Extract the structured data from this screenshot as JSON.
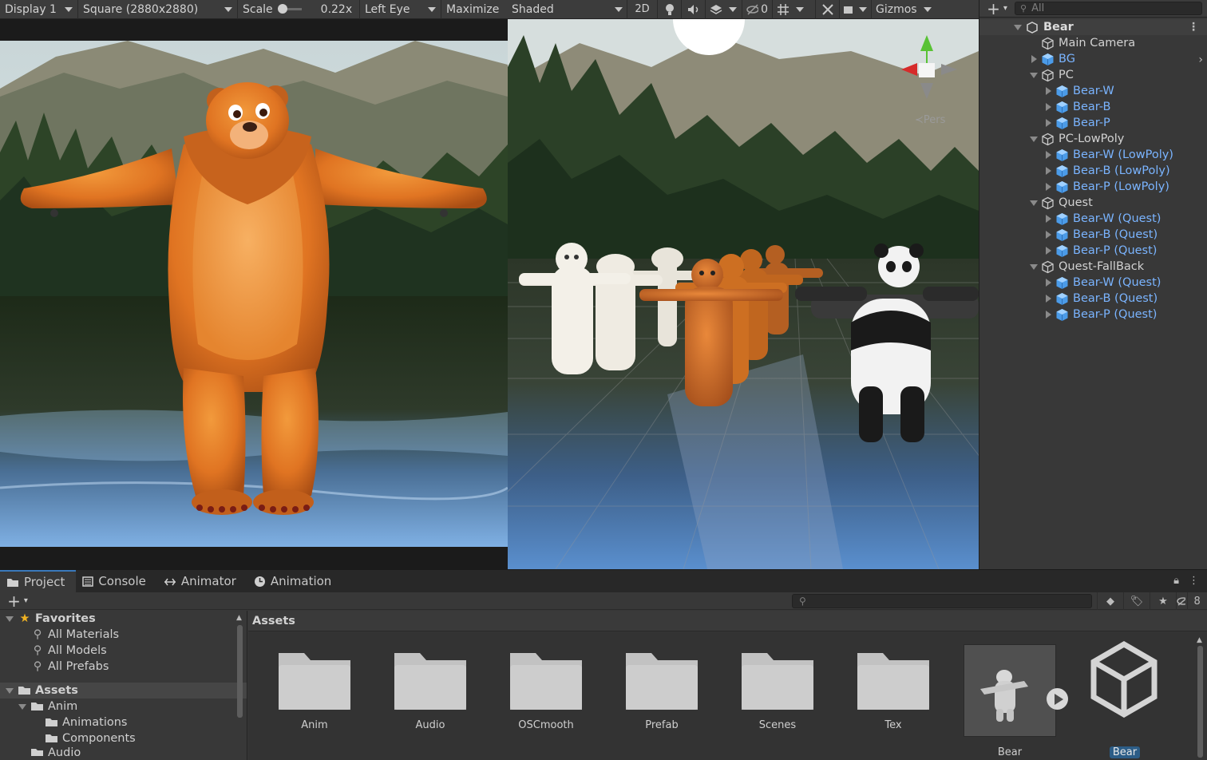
{
  "game_toolbar": {
    "display": "Display 1",
    "aspect": "Square (2880x2880)",
    "scale_label": "Scale",
    "scale_value": "0.22x",
    "eye": "Left Eye",
    "maximize": "Maximize"
  },
  "scene_toolbar": {
    "shading": "Shaded",
    "mode_2d": "2D",
    "hidden_count": "0",
    "gizmos": "Gizmos"
  },
  "hierarchy": {
    "search_placeholder": "All",
    "scene_name": "Bear",
    "items": [
      {
        "label": "Main Camera",
        "depth": 1,
        "kind": "go",
        "arrow": "none"
      },
      {
        "label": "BG",
        "depth": 1,
        "kind": "prefab",
        "arrow": "closed"
      },
      {
        "label": "PC",
        "depth": 1,
        "kind": "go",
        "arrow": "open"
      },
      {
        "label": "Bear-W",
        "depth": 2,
        "kind": "prefab",
        "arrow": "closed"
      },
      {
        "label": "Bear-B",
        "depth": 2,
        "kind": "prefab",
        "arrow": "closed"
      },
      {
        "label": "Bear-P",
        "depth": 2,
        "kind": "prefab",
        "arrow": "closed"
      },
      {
        "label": "PC-LowPoly",
        "depth": 1,
        "kind": "go",
        "arrow": "open"
      },
      {
        "label": "Bear-W (LowPoly)",
        "depth": 2,
        "kind": "prefab",
        "arrow": "closed"
      },
      {
        "label": "Bear-B (LowPoly)",
        "depth": 2,
        "kind": "prefab",
        "arrow": "closed"
      },
      {
        "label": "Bear-P (LowPoly)",
        "depth": 2,
        "kind": "prefab",
        "arrow": "closed"
      },
      {
        "label": "Quest",
        "depth": 1,
        "kind": "go",
        "arrow": "open"
      },
      {
        "label": "Bear-W (Quest)",
        "depth": 2,
        "kind": "prefab",
        "arrow": "closed"
      },
      {
        "label": "Bear-B (Quest)",
        "depth": 2,
        "kind": "prefab",
        "arrow": "closed"
      },
      {
        "label": "Bear-P (Quest)",
        "depth": 2,
        "kind": "prefab",
        "arrow": "closed"
      },
      {
        "label": "Quest-FallBack",
        "depth": 1,
        "kind": "go",
        "arrow": "open"
      },
      {
        "label": "Bear-W (Quest)",
        "depth": 2,
        "kind": "prefab",
        "arrow": "closed"
      },
      {
        "label": "Bear-B (Quest)",
        "depth": 2,
        "kind": "prefab",
        "arrow": "closed"
      },
      {
        "label": "Bear-P (Quest)",
        "depth": 2,
        "kind": "prefab",
        "arrow": "closed"
      }
    ]
  },
  "bottom_tabs": {
    "project": "Project",
    "console": "Console",
    "animator": "Animator",
    "animation": "Animation",
    "hidden_count": "8"
  },
  "project_tree": {
    "favorites": "Favorites",
    "fav_items": [
      "All Materials",
      "All Models",
      "All Prefabs"
    ],
    "assets": "Assets",
    "anim": "Anim",
    "anim_children": [
      "Animations",
      "Components"
    ],
    "audio": "Audio"
  },
  "assets_panel": {
    "breadcrumb": "Assets",
    "folders": [
      "Anim",
      "Audio",
      "OSCmooth",
      "Prefab",
      "Scenes",
      "Tex"
    ],
    "model_label": "Bear",
    "scene_label": "Bear"
  },
  "colors": {
    "prefab_blue": "#7ab4ff",
    "accent": "#3a79bb",
    "selection_blue": "#2c5d87"
  }
}
